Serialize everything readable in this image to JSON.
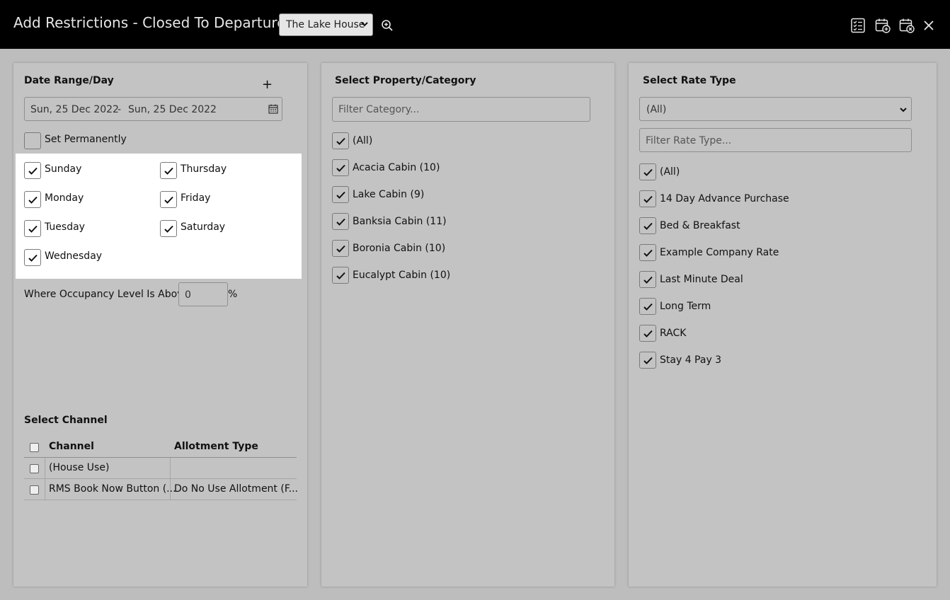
{
  "header": {
    "title": "Add Restrictions - Closed To Departure",
    "property_select": "The Lake House"
  },
  "date_panel": {
    "heading": "Date Range/Day",
    "add_label": "+",
    "date_from": "Sun, 25 Dec 2022",
    "date_sep": "-",
    "date_to": "Sun, 25 Dec 2022",
    "set_permanently": "Set Permanently",
    "days": [
      "Sunday",
      "Thursday",
      "Monday",
      "Friday",
      "Tuesday",
      "Saturday",
      "Wednesday"
    ],
    "occupancy_label": "Where Occupancy Level Is Above",
    "occupancy_value": "0",
    "occupancy_unit": "%",
    "channel_heading": "Select Channel",
    "channel_table": {
      "headers": [
        "Channel",
        "Allotment Type"
      ],
      "rows": [
        [
          "(House Use)",
          ""
        ],
        [
          "RMS Book Now Button (...",
          "Do No Use Allotment (F..."
        ]
      ]
    }
  },
  "category_panel": {
    "heading": "Select Property/Category",
    "filter_placeholder": "Filter Category...",
    "items": [
      "(All)",
      "Acacia Cabin (10)",
      "Lake Cabin (9)",
      "Banksia Cabin (11)",
      "Boronia Cabin (10)",
      "Eucalypt Cabin (10)"
    ]
  },
  "rate_panel": {
    "heading": "Select Rate Type",
    "rate_select": "(All)",
    "filter_placeholder": "Filter Rate Type...",
    "items": [
      "(All)",
      "14 Day Advance Purchase",
      "Bed & Breakfast",
      "Example Company Rate",
      "Last Minute Deal",
      "Long Term",
      "RACK",
      "Stay 4 Pay 3"
    ]
  }
}
